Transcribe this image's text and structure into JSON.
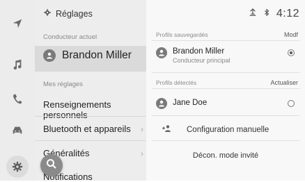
{
  "nav_icons": [
    "navigation-arrow-icon",
    "music-note-icon",
    "phone-icon",
    "car-icon",
    "settings-gear-icon"
  ],
  "settings": {
    "title": "Réglages",
    "current_driver_section": "Conducteur actuel",
    "current_driver_name": "Brandon Miller",
    "my_settings_section": "Mes réglages",
    "menu": [
      {
        "label": "Renseignements personnels"
      },
      {
        "label": "Bluetooth et appareils"
      },
      {
        "label": "Généralités"
      },
      {
        "label": "Notifications"
      }
    ]
  },
  "status": {
    "time": "4:12"
  },
  "profiles": {
    "saved_section": "Profils sauvegardés",
    "saved_action": "Modf",
    "saved": [
      {
        "name": "Brandon Miller",
        "subtitle": "Conducteur principal",
        "selected": true
      }
    ],
    "detected_section": "Profils détectés",
    "detected_action": "Actualiser",
    "detected": [
      {
        "name": "Jane Doe",
        "selected": false
      }
    ],
    "manual_config": "Configuration manuelle",
    "guest_mode": "Décon. mode invité"
  },
  "colors": {
    "background": "#f4f4f4",
    "selected_row": "#dadada",
    "accent_gray": "#7a7a7a"
  }
}
